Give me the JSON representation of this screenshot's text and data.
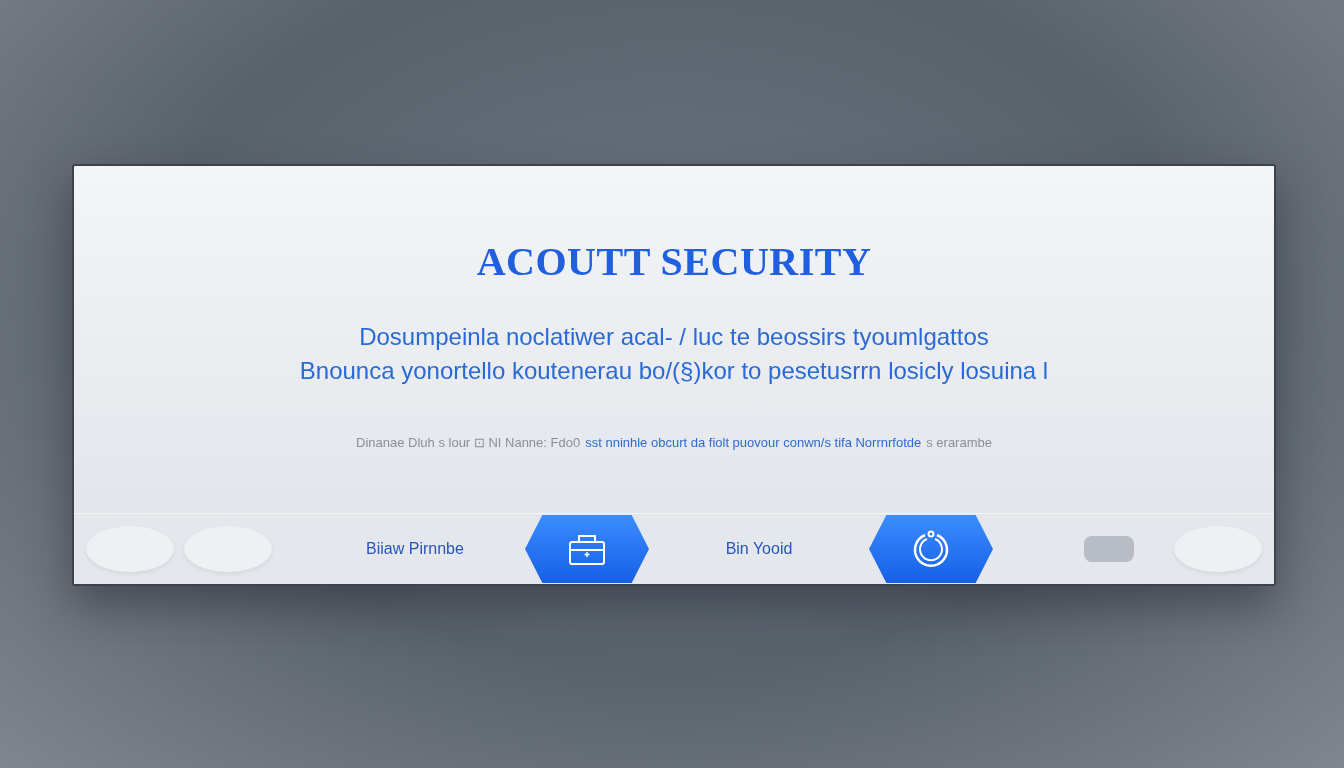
{
  "panel": {
    "title": "ACOUTT SECURITY",
    "body_lines": [
      "Dosumpeinla noclatiwer acal- / luc te beossirs tyoumlgattos",
      "Bnounca yonortello koutenerau bo/(§)kor to pesetusrrn losicly losuina  l"
    ],
    "footnote": [
      {
        "text": "Dinanae Dluh s lour ⊡ NI Nanne: Fdo0",
        "kind": "muted"
      },
      {
        "text": "sst nninhle obcurt da fiolt puovour conwn/s tifa Norrnrfotde",
        "kind": "link"
      },
      {
        "text": "s erarambe",
        "kind": "muted"
      }
    ]
  },
  "action_bar": {
    "items": [
      {
        "kind": "link",
        "label": "Biiaw Pirnnbe"
      },
      {
        "kind": "case"
      },
      {
        "kind": "link",
        "label": "Bin Yooid"
      },
      {
        "kind": "power"
      }
    ],
    "toggle": {
      "on": false
    }
  }
}
